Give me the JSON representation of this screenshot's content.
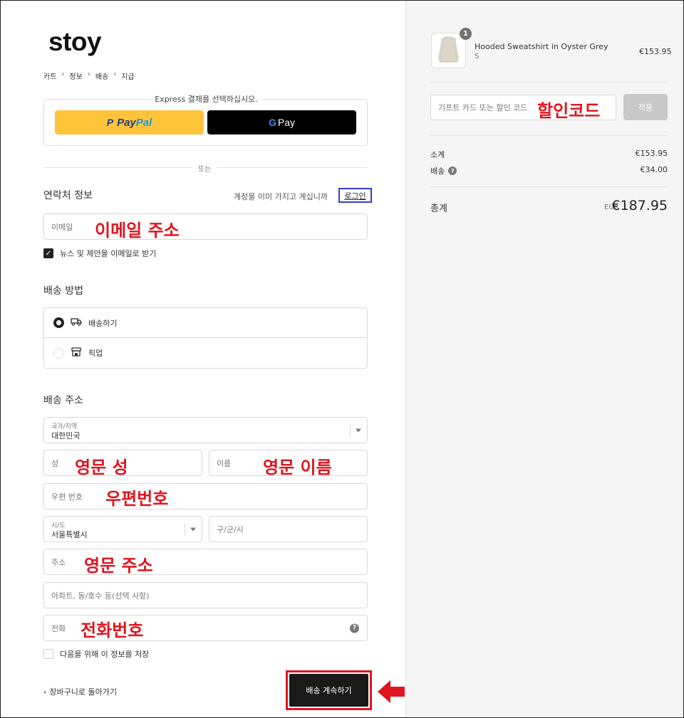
{
  "brand": {
    "logo_text": "stoy"
  },
  "breadcrumb": [
    "카트",
    "정보",
    "배송",
    "지급"
  ],
  "express": {
    "title": "Express 결제를 선택하십시오.",
    "paypal_part1": "Pay",
    "paypal_part2": "Pal",
    "gpay_g": "G",
    "gpay_text": "Pay"
  },
  "divider_or": "또는",
  "contact": {
    "title": "연락처 정보",
    "login_prompt": "계정을 이미 가지고 계십니까",
    "login_link": "로그인",
    "email_placeholder": "이메일",
    "email_annotation": "이메일 주소",
    "newsletter_label": "뉴스 및 제안을 이메일로 받기",
    "newsletter_checked": true
  },
  "shipping_method": {
    "title": "배송 방법",
    "options": [
      {
        "label": "배송하기",
        "selected": true,
        "icon": "truck-icon"
      },
      {
        "label": "픽업",
        "selected": false,
        "icon": "store-icon"
      }
    ]
  },
  "address": {
    "title": "배송 주소",
    "country_label": "국가/지역",
    "country_value": "대한민국",
    "last_name_placeholder": "성",
    "last_name_annotation": "영문 성",
    "first_name_placeholder": "이름",
    "first_name_annotation": "영문 이름",
    "postal_placeholder": "우편 번호",
    "postal_annotation": "우편번호",
    "province_label": "시/도",
    "province_value": "서울특별시",
    "city_placeholder": "구/군/시",
    "address_placeholder": "주소",
    "address_annotation": "영문 주소",
    "apartment_placeholder": "아파트, 동/호수 등(선택 사항)",
    "phone_placeholder": "전화",
    "phone_annotation": "전화번호",
    "save_info_label": "다음을 위해 이 정보를 저장",
    "save_info_checked": false
  },
  "footer": {
    "back_link": "장바구니로 돌아가기",
    "continue_button": "배송 계속하기"
  },
  "order": {
    "item": {
      "name": "Hooded Sweatshirt in Oyster Grey",
      "variant": "S",
      "price": "€153.95",
      "quantity_badge": "1"
    },
    "discount_placeholder": "기프트 카드 또는 할인 코드",
    "discount_annotation": "할인코드",
    "apply_button": "적용",
    "subtotal_label": "소계",
    "subtotal_value": "€153.95",
    "shipping_label": "배송",
    "shipping_value": "€34.00",
    "total_label": "총계",
    "total_currency": "EUR",
    "total_value": "€187.95"
  },
  "colors": {
    "annotation_red": "#e0141e",
    "login_highlight": "#3b3bd1",
    "paypal_yellow": "#ffc439"
  }
}
